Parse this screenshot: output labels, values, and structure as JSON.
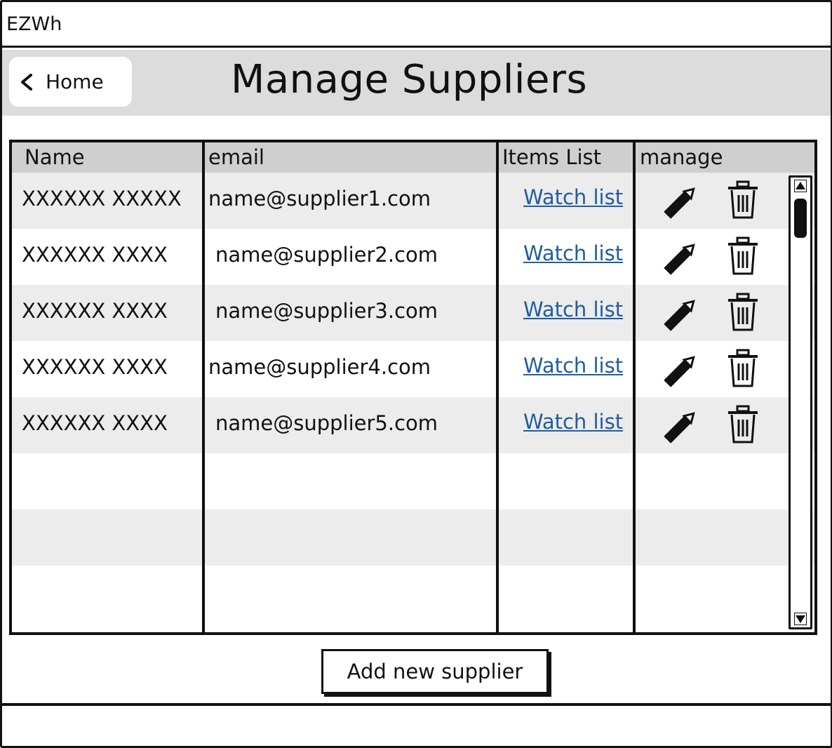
{
  "app": {
    "title": "EZWh"
  },
  "header": {
    "back_label": "Home",
    "page_title": "Manage Suppliers"
  },
  "table": {
    "columns": [
      "Name",
      "email",
      "Items List",
      "manage"
    ],
    "rows": [
      {
        "name": "XXXXXX XXXXX",
        "email": "name@supplier1.com",
        "items": "Watch list"
      },
      {
        "name": "XXXXXX XXXX",
        "email": "name@supplier2.com",
        "items": "Watch list"
      },
      {
        "name": "XXXXXX XXXX",
        "email": "name@supplier3.com",
        "items": "Watch list"
      },
      {
        "name": "XXXXXX XXXX",
        "email": "name@supplier4.com",
        "items": "Watch list"
      },
      {
        "name": "XXXXXX XXXX",
        "email": "name@supplier5.com",
        "items": "Watch list"
      }
    ],
    "empty_rows": 3,
    "icons": {
      "edit": "pencil-icon",
      "delete": "trash-icon"
    }
  },
  "actions": {
    "add_label": "Add new supplier"
  },
  "colors": {
    "header_bg": "#dcdcdc",
    "table_header_bg": "#cfcfcf",
    "stripe": "#ececec",
    "link": "#1f5da0"
  }
}
